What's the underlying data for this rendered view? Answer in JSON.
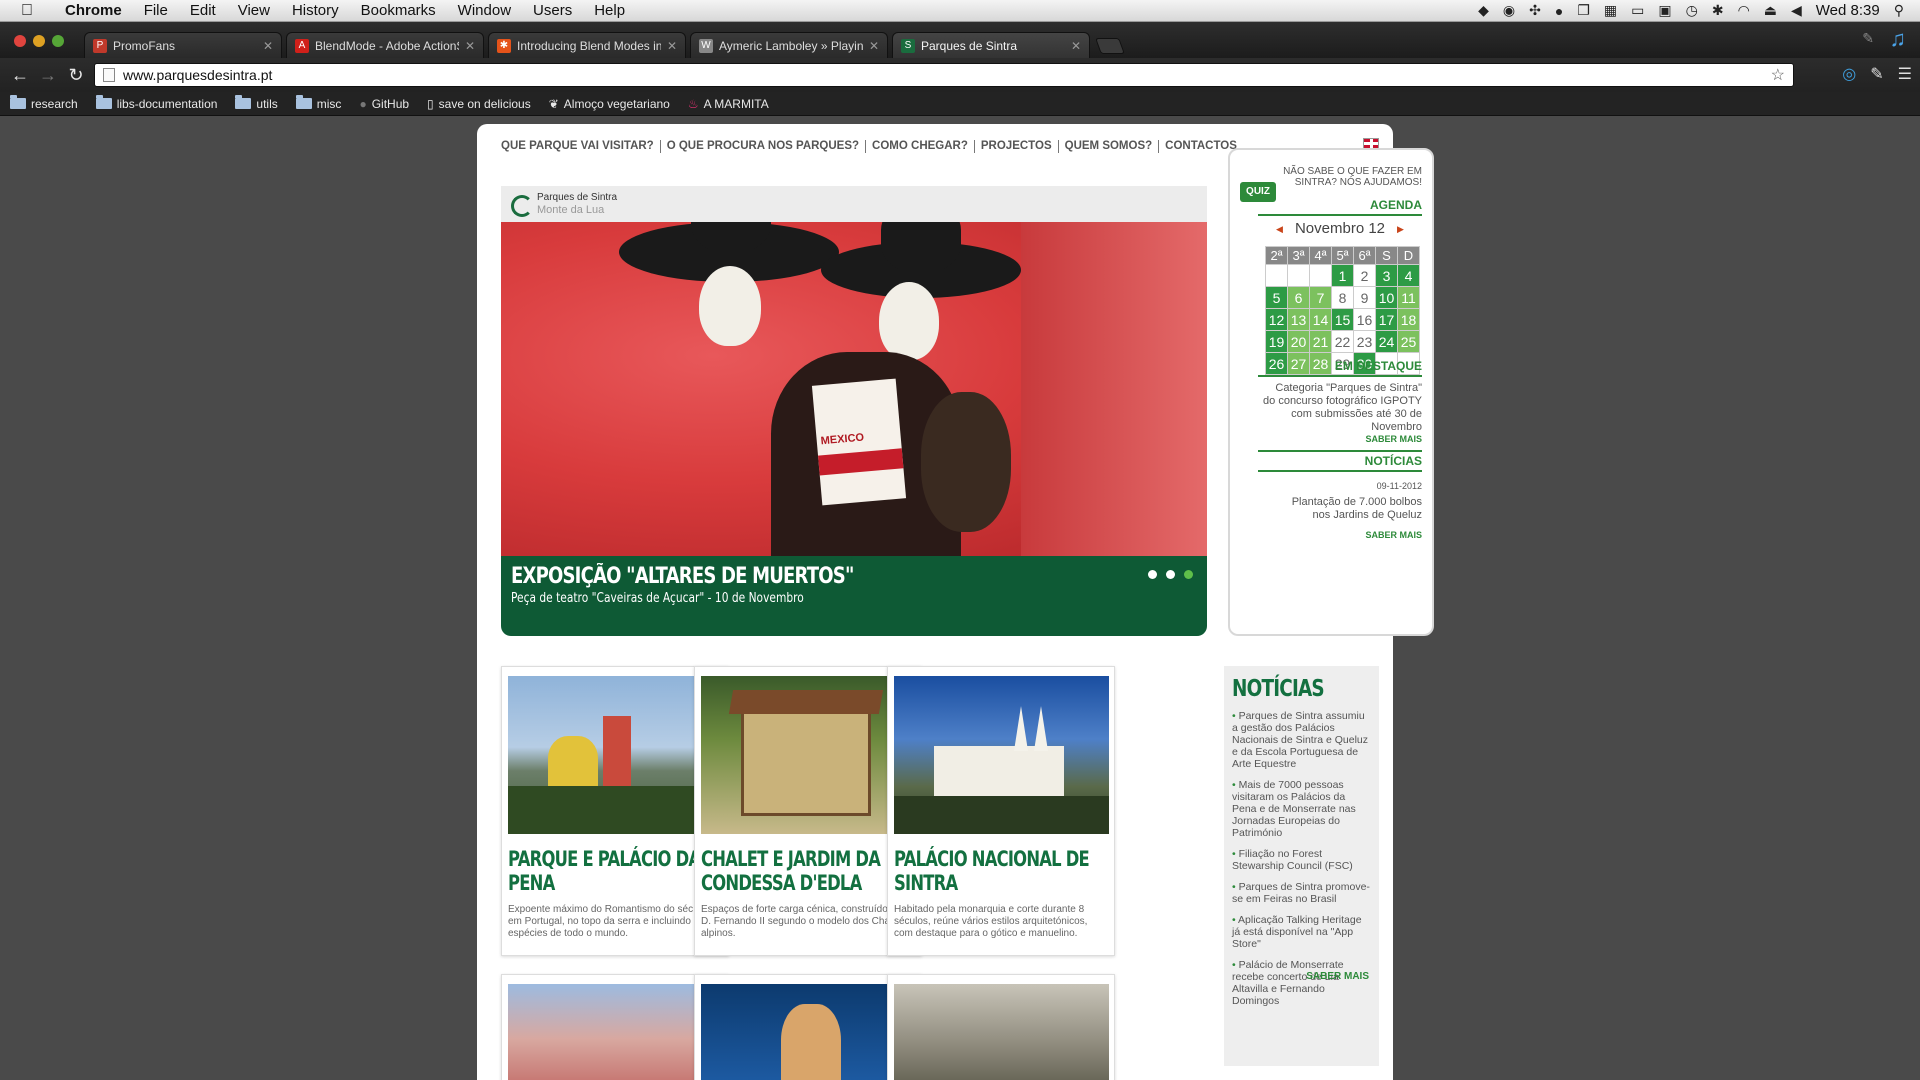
{
  "menubar": {
    "app": "Chrome",
    "items": [
      "File",
      "Edit",
      "View",
      "History",
      "Bookmarks",
      "Window",
      "Users",
      "Help"
    ],
    "clock": "Wed 8:39"
  },
  "tabs": [
    {
      "label": "PromoFans",
      "fav_color": "#c0392b",
      "fav_char": "P"
    },
    {
      "label": "BlendMode - Adobe ActionS",
      "fav_color": "#d0201a",
      "fav_char": "A"
    },
    {
      "label": "Introducing Blend Modes in",
      "fav_color": "#e5531a",
      "fav_char": "✱"
    },
    {
      "label": "Aymeric Lamboley » Playing",
      "fav_color": "#888888",
      "fav_char": "W"
    },
    {
      "label": "Parques de Sintra",
      "fav_color": "#1a6c3e",
      "fav_char": "S"
    }
  ],
  "toolbar": {
    "url": "www.parquesdesintra.pt"
  },
  "bookmarks": [
    {
      "label": "research",
      "type": "folder"
    },
    {
      "label": "libs-documentation",
      "type": "folder"
    },
    {
      "label": "utils",
      "type": "folder"
    },
    {
      "label": "misc",
      "type": "folder"
    },
    {
      "label": "GitHub",
      "type": "github-icon"
    },
    {
      "label": "save on delicious",
      "type": "page-icon"
    },
    {
      "label": "Almoço vegetariano",
      "type": "leaf-icon"
    },
    {
      "label": "A MARMITA",
      "type": "pot-icon"
    }
  ],
  "site": {
    "nav": [
      "QUE PARQUE VAI VISITAR?",
      "O QUE PROCURA NOS PARQUES?",
      "COMO CHEGAR?",
      "PROJECTOS",
      "QUEM SOMOS?",
      "CONTACTOS"
    ],
    "logo_name": "Parques de Sintra",
    "logo_sub": "Monte da Lua",
    "hero_title": "EXPOSIÇÃO \"ALTARES DE MUERTOS\"",
    "hero_sub": "Peça de teatro \"Caveiras de Açucar\" - 10 de Novembro",
    "hero_poncho_text": "MEXICO",
    "widget": {
      "quiz_label": "QUIZ",
      "quiz_text": "NÃO SABE O QUE FAZER EM SINTRA? NÓS AJUDAMOS!",
      "agenda_title": "AGENDA",
      "month": "Novembro 12",
      "weekdays": [
        "2ª",
        "3ª",
        "4ª",
        "5ª",
        "6ª",
        "S",
        "D"
      ],
      "featured_title": "EM DESTAQUE",
      "featured_text": "Categoria \"Parques de Sintra\" do concurso fotográfico IGPOTY com submissões até 30 de Novembro",
      "featured_more": "SABER MAIS",
      "news_title": "NOTÍCIAS",
      "news_date": "09-11-2012",
      "news_text": "Plantação de 7.000 bolbos nos Jardins de Queluz",
      "news_more": "SABER MAIS"
    },
    "cards": [
      {
        "title": "PARQUE E PALÁCIO DA PENA",
        "desc": "Expoente máximo do Romantismo do séc. XIX em Portugal, no topo da serra e incluindo espécies de todo o mundo."
      },
      {
        "title": "CHALET E JARDIM DA CONDESSA D'EDLA",
        "desc": "Espaços de forte carga cénica, construídos por D. Fernando II segundo o modelo dos Chalets alpinos."
      },
      {
        "title": "PALÁCIO NACIONAL DE SINTRA",
        "desc": "Habitado pela monarquia e corte durante 8 séculos, reúne vários estilos arquitetónicos, com destaque para o gótico e manuelino."
      }
    ],
    "newsbox": {
      "title": "NOTÍCIAS",
      "items": [
        "Parques de Sintra assumiu a gestão dos Palácios Nacionais de Sintra e Queluz e da Escola Portuguesa de Arte Equestre",
        "Mais de 7000 pessoas visitaram os Palácios da Pena e de Monserrate nas Jornadas Europeias do Património",
        "Filiação no Forest Stewarship Council (FSC)",
        "Parques de Sintra promove-se em Feiras no Brasil",
        "Aplicação Talking Heritage já está disponível na \"App Store\"",
        "Palácio de Monserrate recebe concerto de Lia Altavilla e Fernando Domingos"
      ],
      "more": "SABER MAIS"
    }
  }
}
